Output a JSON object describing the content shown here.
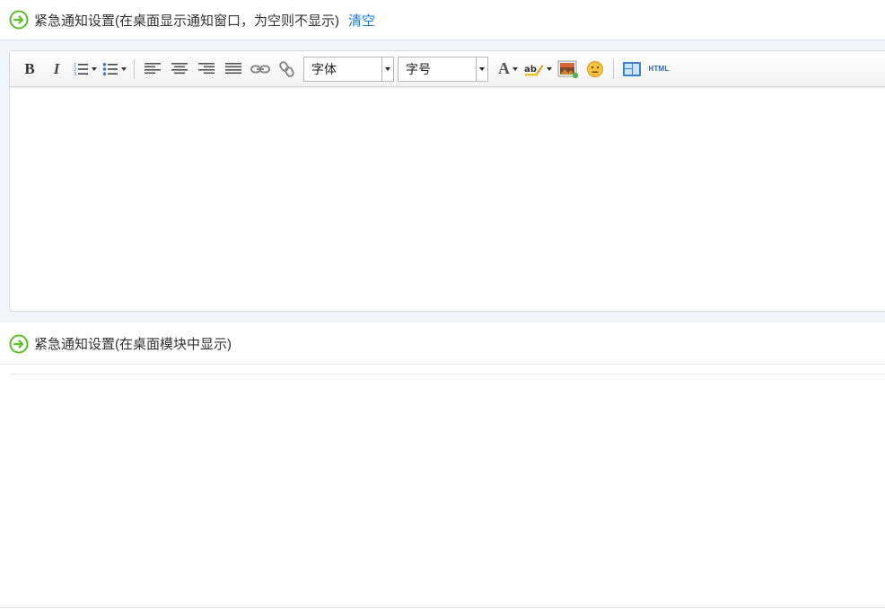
{
  "section1": {
    "title": "紧急通知设置(在桌面显示通知窗口，为空则不显示)",
    "clear_label": "清空"
  },
  "toolbar": {
    "bold_label": "B",
    "italic_label": "I",
    "font_family_value": "字体",
    "font_size_value": "字号",
    "font_color_label": "A",
    "html_label": "HTML",
    "icons": [
      "bold",
      "italic",
      "ordered-list",
      "unordered-list",
      "align-left",
      "align-center",
      "align-right",
      "align-justify",
      "link",
      "unlink",
      "font-color",
      "highlight",
      "image",
      "emoticon",
      "template",
      "html-source"
    ]
  },
  "section2": {
    "title": "紧急通知设置(在桌面模块中显示)"
  },
  "colors": {
    "accent_green": "#5cbf2a",
    "link_blue": "#1a7bd1",
    "band_bg": "#f1f6fb"
  }
}
